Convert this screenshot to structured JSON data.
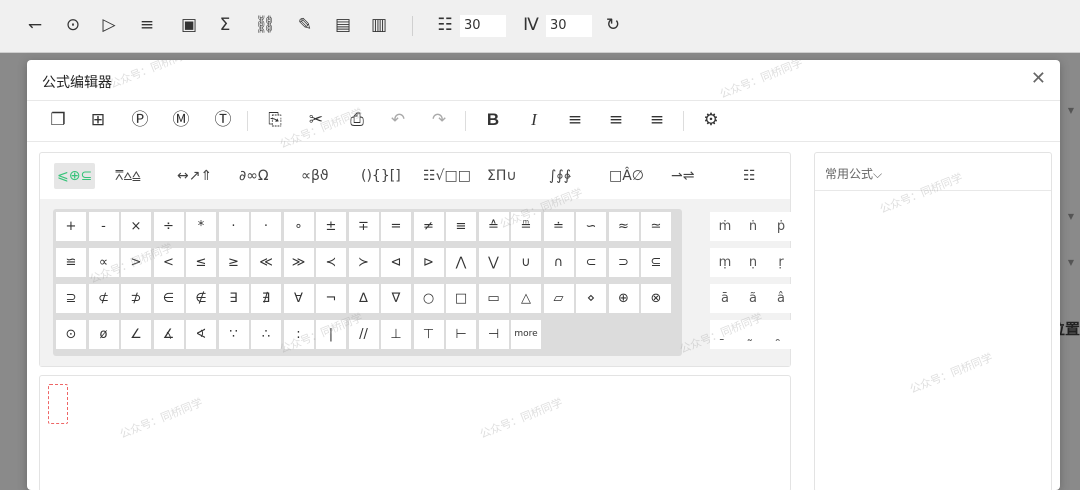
{
  "background_toolbar": {
    "items": [
      {
        "name": "undo-redo-icon",
        "glyph": "↽"
      },
      {
        "name": "comment-icon",
        "glyph": "⊙"
      },
      {
        "name": "shape-icon",
        "glyph": "▷"
      },
      {
        "name": "list-icon",
        "glyph": "≡"
      },
      {
        "name": "image-icon",
        "glyph": "▣"
      },
      {
        "name": "sigma-icon",
        "glyph": "Σ"
      },
      {
        "name": "link-icon",
        "glyph": "⛓"
      },
      {
        "name": "pen-icon",
        "glyph": "✎"
      },
      {
        "name": "speech-icon",
        "glyph": "▤"
      },
      {
        "name": "panel-icon",
        "glyph": "▥"
      }
    ],
    "column_spacing_icon": "☷",
    "column_spacing_value": "30",
    "row_spacing_icon": "Ⅳ",
    "row_spacing_value": "30",
    "refresh_icon": "↻"
  },
  "background_right_label": "位置",
  "dialog": {
    "title": "公式编辑器",
    "close_glyph": "✕"
  },
  "editor_toolbar": [
    {
      "name": "open-folder-icon",
      "glyph": "❐",
      "disabled": false
    },
    {
      "name": "new-icon",
      "glyph": "⊞",
      "disabled": false
    },
    {
      "name": "insert-p-icon",
      "glyph": "Ⓟ",
      "disabled": false
    },
    {
      "name": "insert-m-icon",
      "glyph": "Ⓜ",
      "disabled": false
    },
    {
      "name": "insert-t-icon",
      "glyph": "Ⓣ",
      "disabled": false
    },
    {
      "name": "copy-icon",
      "glyph": "⎘",
      "disabled": false
    },
    {
      "name": "cut-icon",
      "glyph": "✂",
      "disabled": false
    },
    {
      "name": "paste-icon",
      "glyph": "⎙",
      "disabled": false
    },
    {
      "name": "undo-icon",
      "glyph": "↶",
      "disabled": true
    },
    {
      "name": "redo-icon",
      "glyph": "↷",
      "disabled": true
    },
    {
      "name": "bold-icon",
      "glyph": "B",
      "disabled": false
    },
    {
      "name": "italic-icon",
      "glyph": "I",
      "disabled": false
    },
    {
      "name": "align-left-icon",
      "glyph": "≡",
      "disabled": false
    },
    {
      "name": "align-center-icon",
      "glyph": "≡",
      "disabled": false
    },
    {
      "name": "align-right-icon",
      "glyph": "≡",
      "disabled": false
    },
    {
      "name": "settings-icon",
      "glyph": "⚙",
      "disabled": false
    }
  ],
  "symbol_groups": [
    "⩽⊕⊆",
    "⩞⩟⩠",
    "↔↗⇑",
    "∂∞Ω",
    "∝βϑ",
    "(){}[]",
    "☷√□□",
    "ΣΠ∪",
    "∫∮∳",
    "□Â∅",
    "⇀⇌",
    "☷"
  ],
  "symbols": [
    [
      "+",
      "-",
      "×",
      "÷",
      "*",
      "·",
      "·",
      "∘",
      "±",
      "∓",
      "=",
      "≠",
      "≡",
      "≙",
      "≞",
      "≐",
      "∽",
      "≈",
      "≃"
    ],
    [
      "≌",
      "∝",
      ">",
      "<",
      "≤",
      "≥",
      "≪",
      "≫",
      "≺",
      "≻",
      "⊲",
      "⊳",
      "⋀",
      "⋁",
      "∪",
      "∩",
      "⊂",
      "⊃",
      "⊆"
    ],
    [
      "⊇",
      "⊄",
      "⊅",
      "∈",
      "∉",
      "∃",
      "∄",
      "∀",
      "¬",
      "∆",
      "∇",
      "○",
      "□",
      "▭",
      "△",
      "▱",
      "⋄",
      "⊕",
      "⊗"
    ],
    [
      "⊙",
      "ø",
      "∠",
      "∡",
      "∢",
      "∵",
      "∴",
      ":",
      "|",
      "//",
      "⊥",
      "⊤",
      "⊢",
      "⊣",
      "more"
    ]
  ],
  "accents": [
    [
      "ṁ",
      "ṅ",
      "ṗ"
    ],
    [
      "ṃ",
      "ṇ",
      "ṛ"
    ],
    [
      "ā",
      "ã",
      "â"
    ],
    [
      "̱",
      "̰",
      "̯"
    ]
  ],
  "common_formulas_label": "常用公式⌵",
  "watermark": "公众号：同桥同学"
}
